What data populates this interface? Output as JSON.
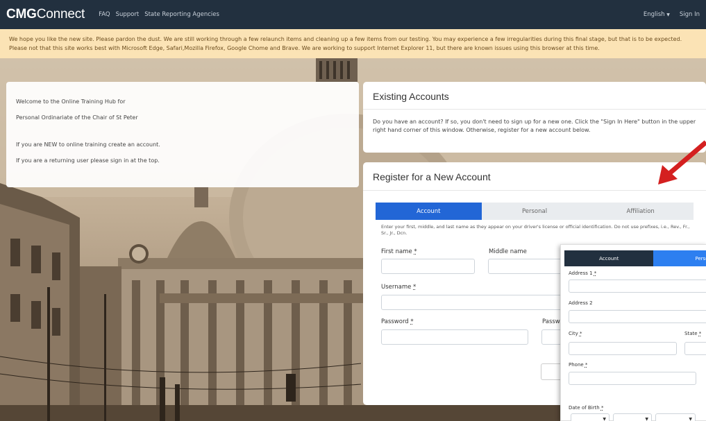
{
  "navbar": {
    "brand_bold": "CMG",
    "brand_rest": "Connect",
    "links": [
      "FAQ",
      "Support",
      "State Reporting Agencies"
    ],
    "language": "English",
    "sign_in": "Sign In"
  },
  "notice": {
    "text": "We hope you like the new site. Please pardon the dust. We are still working through a few relaunch items and cleaning up a few items from our testing. You may experience a few irregularities during this final stage, but that is to be expected. Please not that this site works best with Microsoft Edge, Safari,Mozilla Firefox, Google Chome and Brave. We are working to support Internet Explorer 11, but there are known issues using this browser at this time."
  },
  "welcome": {
    "line1": "Welcome to the Online Training Hub for",
    "line2": "Personal Ordinariate of the Chair of St Peter",
    "line3": "If you are NEW to online training create an account.",
    "line4": "If you are a returning user please sign in at the top."
  },
  "existing": {
    "title": "Existing Accounts",
    "body": "Do you have an account? If so, you don't need to sign up for a new one. Click the \"Sign In Here\" button in the upper right hand corner of this window. Otherwise, register for a new account below."
  },
  "register": {
    "title": "Register for a New Account",
    "tabs": [
      "Account",
      "Personal",
      "Affiliation"
    ],
    "note": "Enter your first, middle, and last name as they appear on your driver's license or official identification. Do not use prefixes, i.e., Rev., Fr., Sr., Jr., Dcn.",
    "first_name": "First name",
    "middle_name": "Middle name",
    "username": "Username",
    "password": "Password",
    "password_confirm": "Passwo",
    "required_mark": "*"
  },
  "overlay": {
    "tab_account": "Account",
    "tab_personal": "Person",
    "address1": "Address 1",
    "address2": "Address 2",
    "city": "City",
    "state": "State",
    "phone": "Phone",
    "dob": "Date of Birth",
    "required_mark": "*"
  },
  "colors": {
    "navbar": "#22303f",
    "notice_bg": "#fbe3b5",
    "tab_active": "#2266d6",
    "arrow": "#d42020"
  }
}
